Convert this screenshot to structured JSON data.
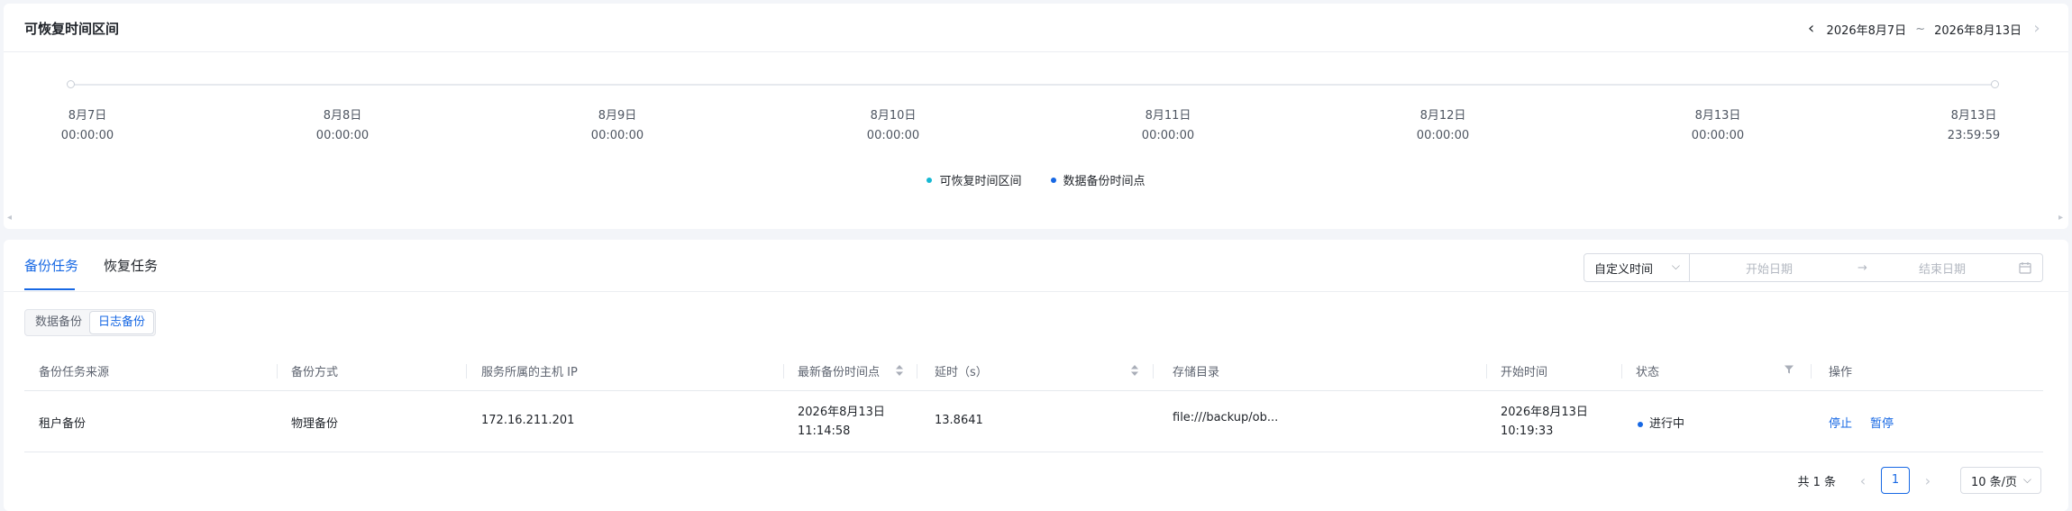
{
  "recovery": {
    "title": "可恢复时间区间",
    "range_start": "2026年8月7日",
    "range_sep": "~",
    "range_end": "2026年8月13日",
    "ticks": [
      {
        "date": "8月7日",
        "time": "00:00:00"
      },
      {
        "date": "8月8日",
        "time": "00:00:00"
      },
      {
        "date": "8月9日",
        "time": "00:00:00"
      },
      {
        "date": "8月10日",
        "time": "00:00:00"
      },
      {
        "date": "8月11日",
        "time": "00:00:00"
      },
      {
        "date": "8月12日",
        "time": "00:00:00"
      },
      {
        "date": "8月13日",
        "time": "00:00:00"
      },
      {
        "date": "8月13日",
        "time": "23:59:59"
      }
    ],
    "legend": [
      {
        "label": "可恢复时间区间",
        "color": "#16b8d3"
      },
      {
        "label": "数据备份时间点",
        "color": "#1768e4"
      }
    ]
  },
  "tasks": {
    "tabs": [
      {
        "label": "备份任务",
        "active": true
      },
      {
        "label": "恢复任务",
        "active": false
      }
    ],
    "filter": {
      "mode": "自定义时间",
      "start_placeholder": "开始日期",
      "end_placeholder": "结束日期"
    },
    "segments": [
      {
        "label": "数据备份",
        "active": false
      },
      {
        "label": "日志备份",
        "active": true
      }
    ],
    "columns": [
      "备份任务来源",
      "备份方式",
      "服务所属的主机 IP",
      "最新备份时间点",
      "延时（s）",
      "存储目录",
      "开始时间",
      "状态",
      "操作"
    ],
    "rows": [
      {
        "source": "租户备份",
        "method": "物理备份",
        "host_ip": "172.16.211.201",
        "latest_date": "2026年8月13日",
        "latest_time": "11:14:58",
        "delay": "13.8641",
        "storage": "file:///backup/ob...",
        "start_date": "2026年8月13日",
        "start_time": "10:19:33",
        "status": "进行中",
        "actions": [
          "停止",
          "暂停"
        ]
      }
    ],
    "pagination": {
      "total": "共 1 条",
      "current_page": "1",
      "page_size": "10 条/页"
    }
  },
  "colors": {
    "primary": "#1768e4",
    "cyan": "#16b8d3",
    "text": "#1f2329",
    "muted": "#5e6470"
  }
}
